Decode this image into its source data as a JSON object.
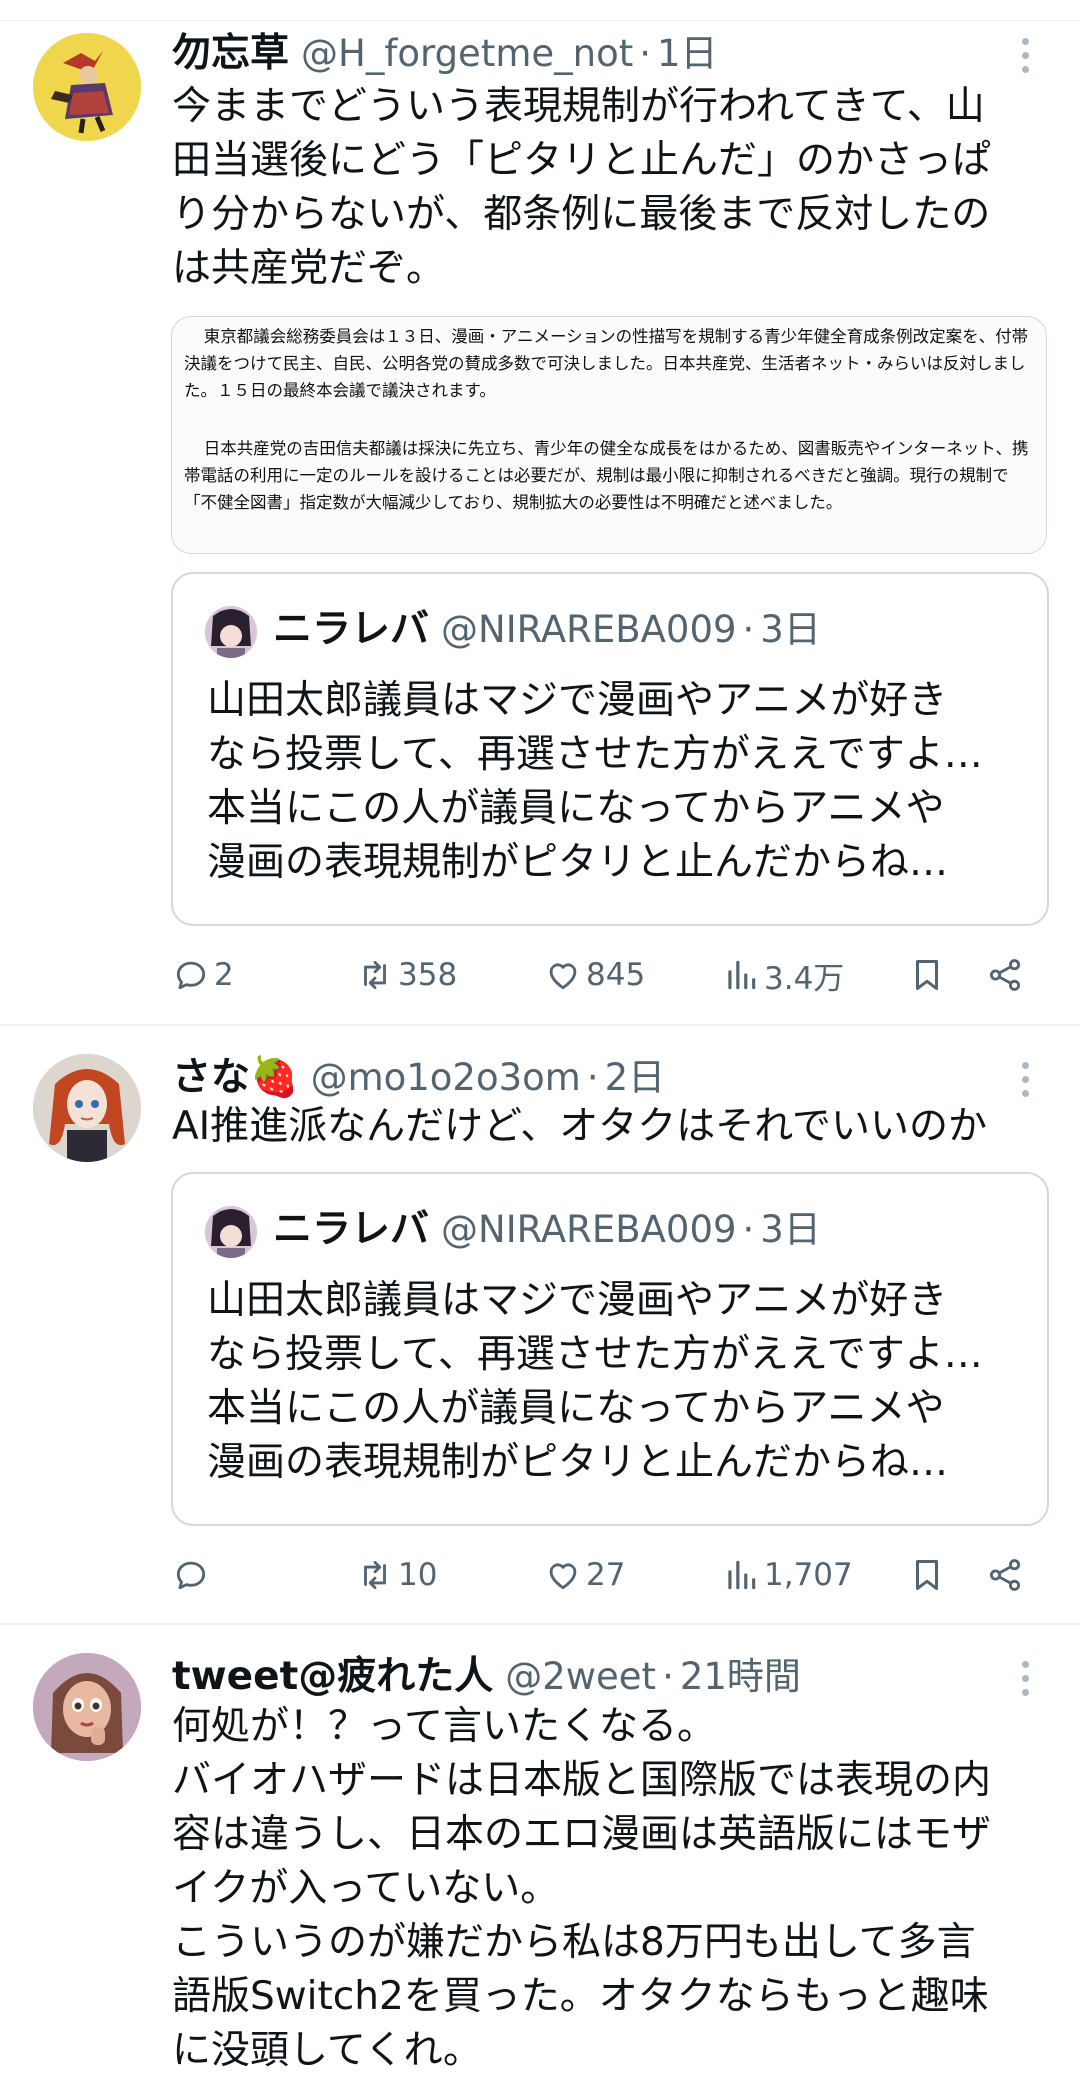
{
  "tweets": [
    {
      "name": "勿忘草",
      "handle": "@H_forgetme_not",
      "time": "1日",
      "text": "今ままでどういう表現規制が行われてきて、山\n田当選後にどう「ピタリと止んだ」のかさっぱ\nり分からないが、都条例に最後まで反対したの\nは共産党だぞ。",
      "article": {
        "p1": "東京都議会総務委員会は１３日、漫画・アニメーションの性描写を規制する青少年健全育成条例改定案を、付帯決議をつけて民主、自民、公明各党の賛成多数で可決しました。日本共産党、生活者ネット・みらいは反対しました。１５日の最終本会議で議決されます。",
        "p2": "日本共産党の吉田信夫都議は採決に先立ち、青少年の健全な成長をはかるため、図書販売やインターネット、携帯電話の利用に一定のルールを設けることは必要だが、規制は最小限に抑制されるべきだと強調。現行の規制で「不健全図書」指定数が大幅減少しており、規制拡大の必要性は不明確だと述べました。"
      },
      "quote": {
        "name": "ニラレバ",
        "handle": "@NIRAREBA009",
        "time": "3日",
        "text": "山田太郎議員はマジで漫画やアニメが好き\nなら投票して、再選させた方がええですよ…\n本当にこの人が議員になってからアニメや\n漫画の表現規制がピタリと止んだからね…"
      },
      "stats": {
        "replies": "2",
        "retweets": "358",
        "likes": "845",
        "views": "3.4万"
      }
    },
    {
      "name": "さな🍓",
      "handle": "@mo1o2o3om",
      "time": "2日",
      "text": "AI推進派なんだけど、オタクはそれでいいのか",
      "quote": {
        "name": "ニラレバ",
        "handle": "@NIRAREBA009",
        "time": "3日",
        "text": "山田太郎議員はマジで漫画やアニメが好き\nなら投票して、再選させた方がええですよ…\n本当にこの人が議員になってからアニメや\n漫画の表現規制がピタリと止んだからね…"
      },
      "stats": {
        "replies": "",
        "retweets": "10",
        "likes": "27",
        "views": "1,707"
      }
    },
    {
      "name": "tweet@疲れた人",
      "handle": "@2weet",
      "time": "21時間",
      "text": "何処が！？って言いたくなる。\nバイオハザードは日本版と国際版では表現の内\n容は違うし、日本のエロ漫画は英語版にはモザ\nイクが入っていない。\nこういうのが嫌だから私は8万円も出して多言\n語版Switch2を買った。オタクならもっと趣味\nに没頭してくれ。"
    }
  ],
  "icons": {
    "reply": "reply-icon",
    "retweet": "retweet-icon",
    "like": "heart-icon",
    "views": "views-icon",
    "bookmark": "bookmark-icon",
    "share": "share-icon",
    "more": "more-icon"
  },
  "colors": {
    "text": "#0f1419",
    "secondary": "#536471",
    "border": "#cfd9de",
    "divider": "#eff3f4"
  }
}
